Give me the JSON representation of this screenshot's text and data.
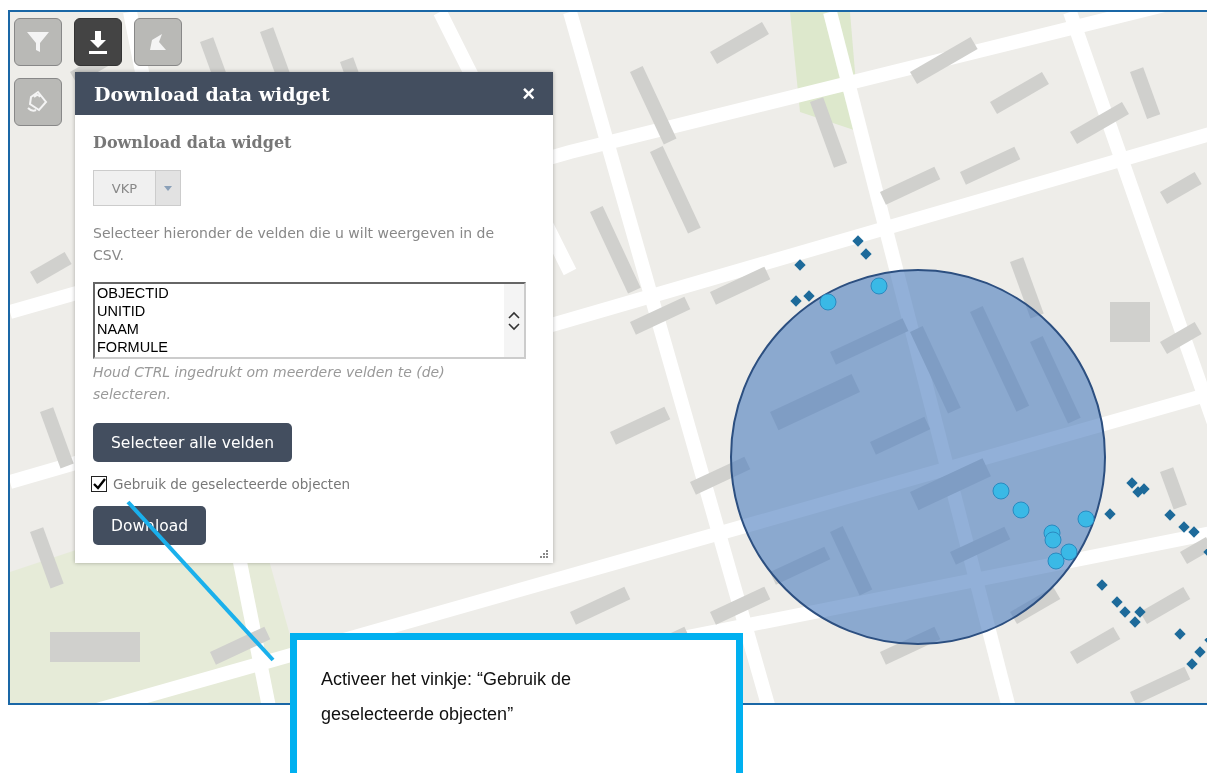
{
  "toolbar": [
    {
      "kind": "filter",
      "selected": false
    },
    {
      "kind": "download",
      "selected": true
    },
    {
      "kind": "shape",
      "selected": false
    },
    {
      "kind": "bucket",
      "selected": false
    }
  ],
  "widget": {
    "title": "Download data widget",
    "close": "×",
    "heading": "Download data widget",
    "dropdown": {
      "value": "VKP"
    },
    "instruction": "Selecteer hieronder de velden die u wilt weergeven in de CSV.",
    "fields": [
      "OBJECTID",
      "UNITID",
      "NAAM",
      "FORMULE"
    ],
    "hint": "Houd CTRL ingedrukt om meerdere velden te (de) selecteren.",
    "select_all_button": "Selecteer alle velden",
    "checkbox": {
      "label": "Gebruik de geselecteerde objecten",
      "checked": true
    },
    "download_button": "Download"
  },
  "callout": {
    "text": "Activeer het vinkje: “Gebruik de geselecteerde objecten”"
  }
}
